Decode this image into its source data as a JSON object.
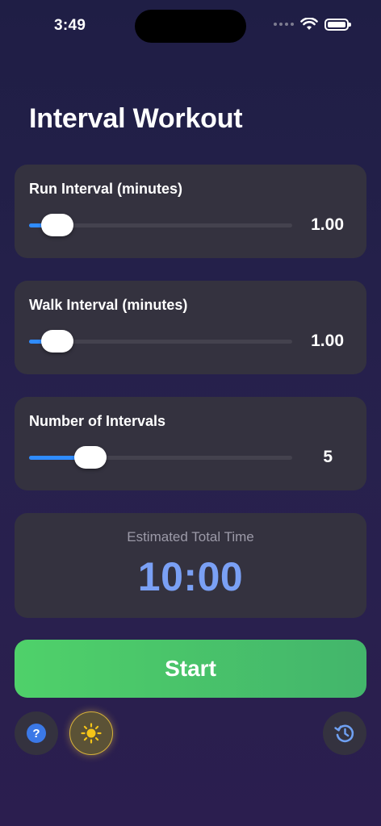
{
  "status_bar": {
    "time": "3:49"
  },
  "header": {
    "title": "Interval Workout"
  },
  "sliders": [
    {
      "label": "Run Interval (minutes)",
      "value_text": "1.00",
      "fraction": 0.06
    },
    {
      "label": "Walk Interval (minutes)",
      "value_text": "1.00",
      "fraction": 0.06
    },
    {
      "label": "Number of Intervals",
      "value_text": "5",
      "fraction": 0.2
    }
  ],
  "estimate": {
    "label": "Estimated Total Time",
    "value": "10:00"
  },
  "actions": {
    "start_label": "Start"
  },
  "bottom_bar": {
    "help_icon": "question-circle-icon",
    "theme_icon": "sun-icon",
    "history_icon": "history-clock-icon"
  },
  "colors": {
    "accent_blue": "#2f8cff",
    "time_blue": "#7aa0f5",
    "start_green": "#4fd16a",
    "card": "#34323f",
    "sun_yellow": "#f5c518"
  }
}
